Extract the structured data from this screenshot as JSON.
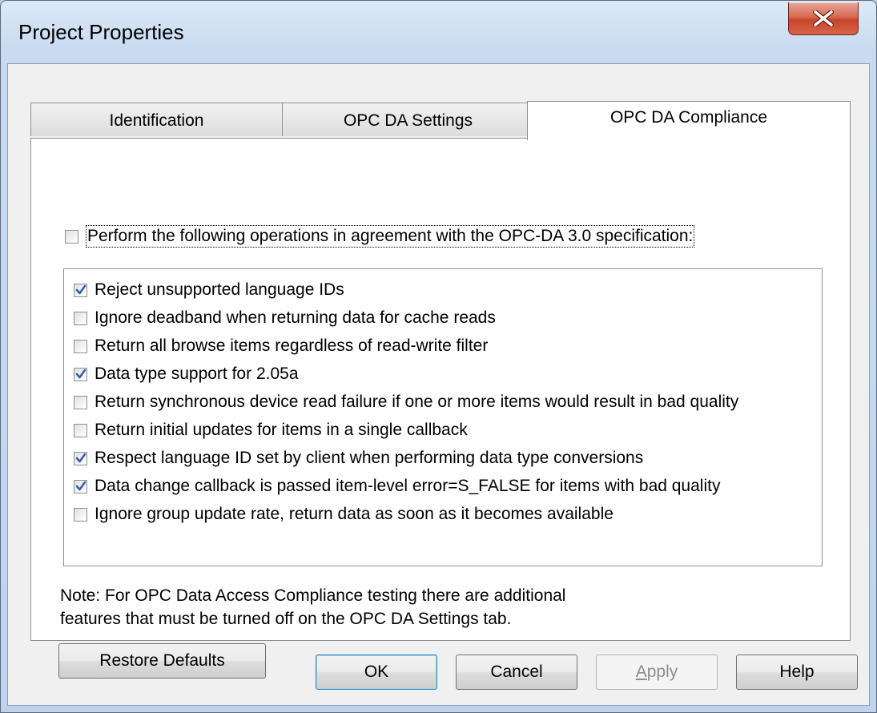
{
  "window": {
    "title": "Project Properties"
  },
  "tabs": [
    {
      "label": "Identification",
      "active": false
    },
    {
      "label": "OPC DA Settings",
      "active": false
    },
    {
      "label": "OPC DA Compliance",
      "active": true
    }
  ],
  "compliance": {
    "main_checkbox": {
      "label": "Perform the following operations in agreement with the OPC-DA 3.0 specification:",
      "checked": false
    },
    "options": [
      {
        "label": "Reject unsupported language IDs",
        "checked": true
      },
      {
        "label": "Ignore deadband when returning data for cache reads",
        "checked": false
      },
      {
        "label": "Return all browse items regardless of read-write filter",
        "checked": false
      },
      {
        "label": "Data type support for 2.05a",
        "checked": true
      },
      {
        "label": "Return synchronous device read failure if one or more items would result in bad quality",
        "checked": false
      },
      {
        "label": "Return initial updates for items in a single callback",
        "checked": false
      },
      {
        "label": "Respect language ID set by client when performing data type conversions",
        "checked": true
      },
      {
        "label": "Data change callback is passed item-level error=S_FALSE for items with bad quality",
        "checked": true
      },
      {
        "label": "Ignore group update rate, return data as soon as it becomes available",
        "checked": false
      }
    ],
    "note_line1": "Note: For OPC Data Access Compliance testing there are additional",
    "note_line2": "features that must be turned off on the OPC DA Settings tab.",
    "restore_defaults": "Restore Defaults"
  },
  "buttons": {
    "ok": "OK",
    "cancel": "Cancel",
    "apply_mnemonic": "A",
    "apply_rest": "pply",
    "help": "Help"
  },
  "colors": {
    "check": "#3a5fa8",
    "close_button": "#c7432b"
  }
}
